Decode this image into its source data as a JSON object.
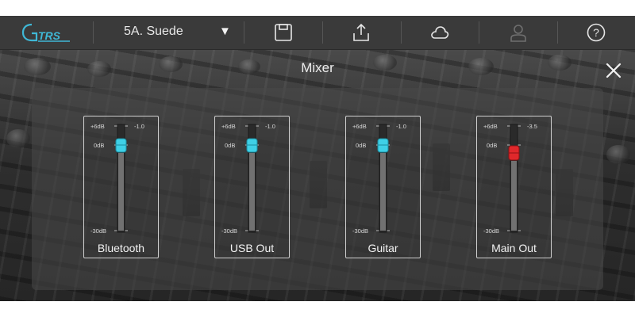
{
  "topbar": {
    "preset_name": "5A. Suede",
    "preset_dropdown_glyph": "▼",
    "logo_text": "GTRS",
    "icons": [
      "save-icon",
      "share-icon",
      "cloud-icon",
      "user-icon",
      "help-icon"
    ]
  },
  "mixer": {
    "title": "Mixer",
    "close_glyph": "✕",
    "channels": [
      {
        "label": "Bluetooth",
        "top_label": "+6dB",
        "zero_label": "0dB",
        "bottom_label": "-30dB",
        "value_text": "-1.0",
        "knob_color": "#3fd0e6"
      },
      {
        "label": "USB Out",
        "top_label": "+6dB",
        "zero_label": "0dB",
        "bottom_label": "-30dB",
        "value_text": "-1.0",
        "knob_color": "#3fd0e6"
      },
      {
        "label": "Guitar",
        "top_label": "+6dB",
        "zero_label": "0dB",
        "bottom_label": "-30dB",
        "value_text": "-1.0",
        "knob_color": "#3fd0e6"
      },
      {
        "label": "Main Out",
        "top_label": "+6dB",
        "zero_label": "0dB",
        "bottom_label": "-30dB",
        "value_text": "-3.5",
        "knob_color": "#e0282b"
      }
    ]
  },
  "colors": {
    "topbar_bg": "#3a3a3a",
    "accent": "#3fd0e6",
    "main_out_knob": "#e0282b"
  }
}
